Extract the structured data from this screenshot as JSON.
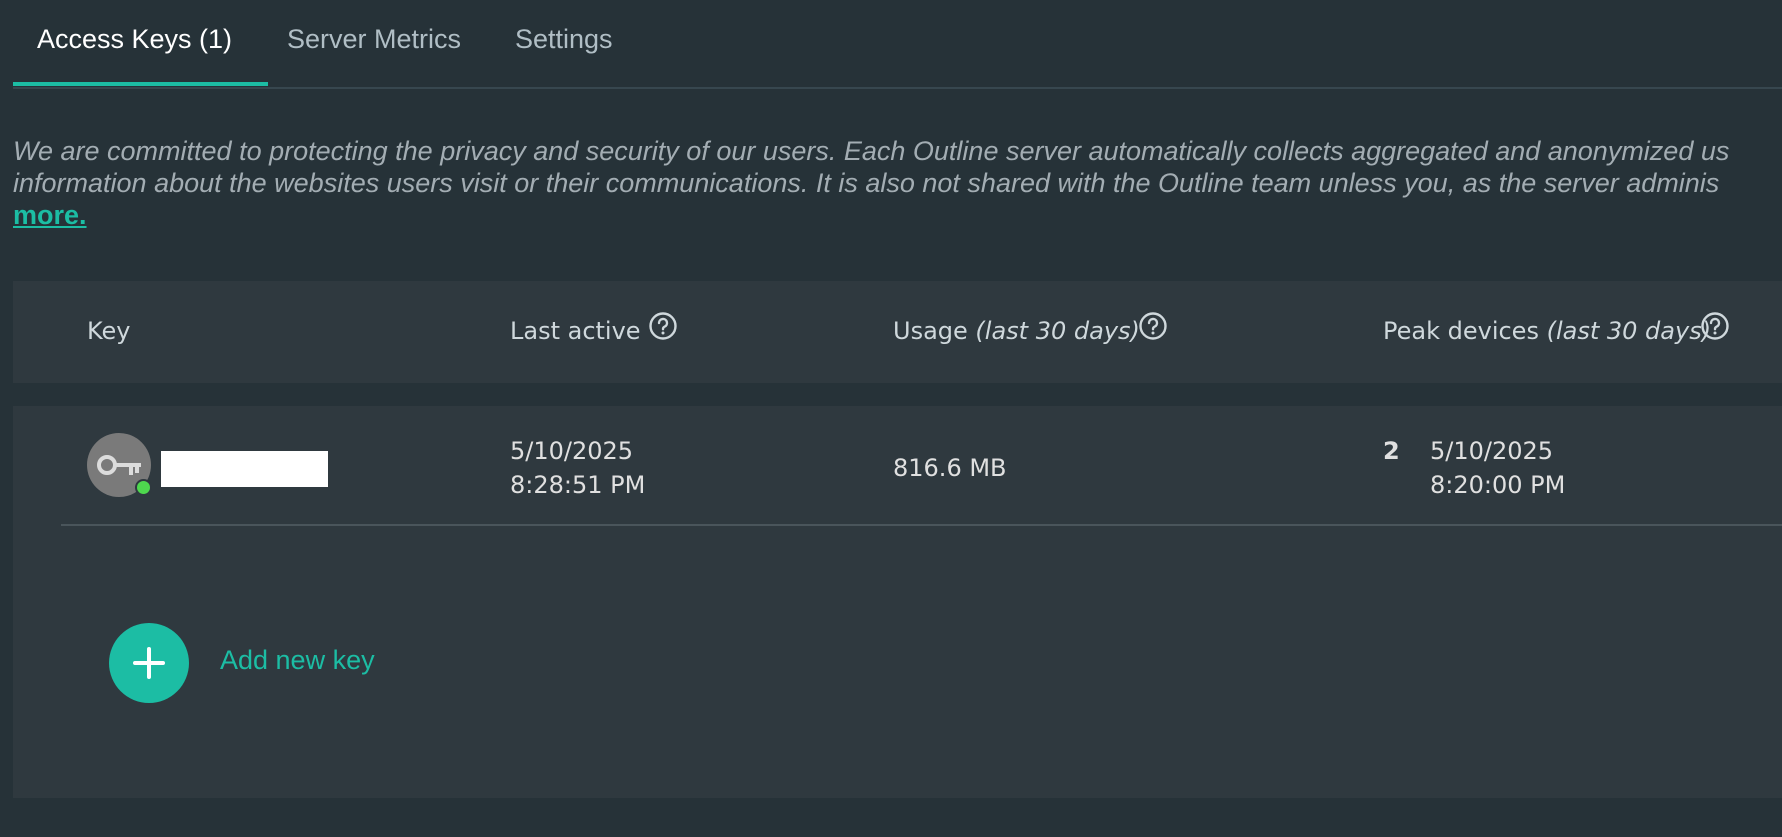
{
  "tabs": [
    {
      "label": "Access Keys (1)",
      "active": true
    },
    {
      "label": "Server Metrics",
      "active": false
    },
    {
      "label": "Settings",
      "active": false
    }
  ],
  "notice": {
    "line1": "We are committed to protecting the privacy and security of our users. Each Outline server automatically collects aggregated and anonymized us",
    "line2": "information about the websites users visit or their communications. It is also not shared with the Outline team unless you, as the server adminis",
    "learn_more": "more."
  },
  "table": {
    "columns": {
      "key": "Key",
      "last_active": "Last active",
      "usage": "Usage",
      "usage_period": "(last 30 days)",
      "peak_devices": "Peak devices",
      "peak_period": "(last 30 days)"
    },
    "rows": [
      {
        "key_name": "",
        "online": true,
        "last_active_date": "5/10/2025",
        "last_active_time": "8:28:51 PM",
        "usage": "816.6 MB",
        "peak_count": "2",
        "peak_date": "5/10/2025",
        "peak_time": "8:20:00 PM"
      }
    ]
  },
  "add_key": {
    "label": "Add new key",
    "icon": "plus-icon"
  },
  "colors": {
    "background": "#263238",
    "panel": "#2f393f",
    "accent": "#1cbda4",
    "online": "#4ed84e"
  }
}
